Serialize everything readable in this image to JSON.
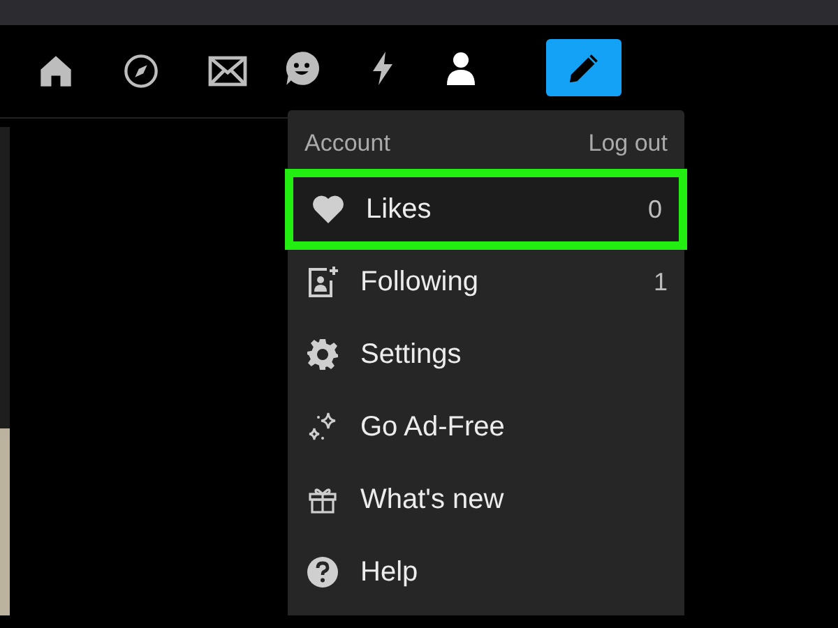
{
  "nav": {
    "items": [
      {
        "kind": "home",
        "selected": false
      },
      {
        "kind": "explore",
        "selected": false
      },
      {
        "kind": "inbox",
        "selected": false
      },
      {
        "kind": "chat",
        "selected": false
      },
      {
        "kind": "activity",
        "selected": false
      },
      {
        "kind": "account",
        "selected": true
      }
    ],
    "compose": {
      "kind": "compose"
    }
  },
  "account_menu": {
    "title": "Account",
    "action": "Log out",
    "items": [
      {
        "kind": "likes",
        "label": "Likes",
        "count": "0",
        "highlighted": true
      },
      {
        "kind": "following",
        "label": "Following",
        "count": "1",
        "highlighted": false
      },
      {
        "kind": "settings",
        "label": "Settings",
        "highlighted": false
      },
      {
        "kind": "adfree",
        "label": "Go Ad-Free",
        "highlighted": false
      },
      {
        "kind": "whatsnew",
        "label": "What's new",
        "highlighted": false
      },
      {
        "kind": "help",
        "label": "Help",
        "highlighted": false
      }
    ]
  }
}
